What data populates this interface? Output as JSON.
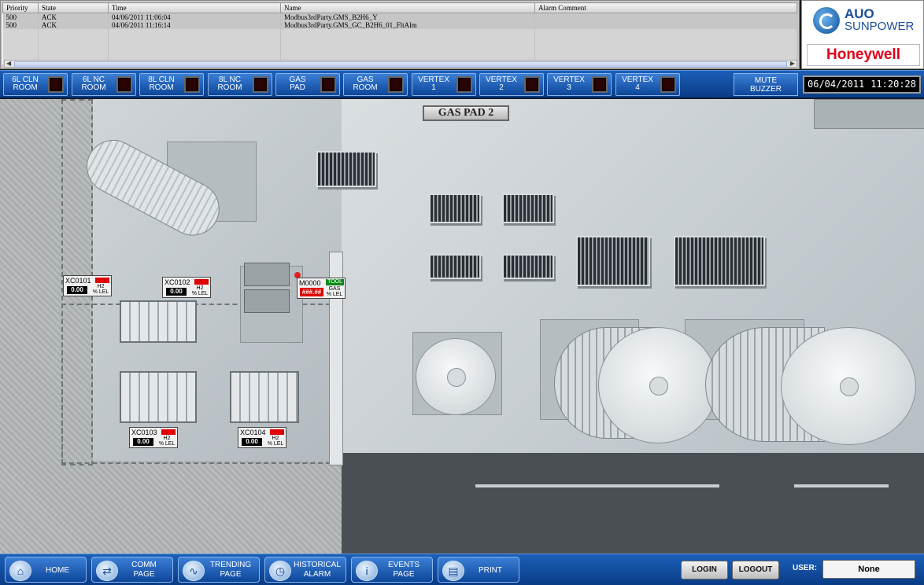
{
  "alarm_table": {
    "columns": [
      "Priority",
      "State",
      "Time",
      "Name",
      "Alarm Comment"
    ],
    "rows": [
      [
        "500",
        "ACK",
        "04/06/2011 11:06:04",
        "Modbus3rdParty.GMS_B2H6_Y",
        ""
      ],
      [
        "500",
        "ACK",
        "04/06/2011 11:16:14",
        "Modbus3rdParty.GMS_GC_B2H6_01_FltAlm",
        ""
      ]
    ]
  },
  "logos": {
    "auo": "AUO",
    "sunpower": "SUNPOWER",
    "honeywell": "Honeywell"
  },
  "status_bar": {
    "zones": [
      {
        "line1": "6L CLN",
        "line2": "ROOM"
      },
      {
        "line1": "6L NC",
        "line2": "ROOM"
      },
      {
        "line1": "8L CLN",
        "line2": "ROOM"
      },
      {
        "line1": "8L NC",
        "line2": "ROOM"
      },
      {
        "line1": "GAS",
        "line2": "PAD"
      },
      {
        "line1": "GAS",
        "line2": "ROOM"
      },
      {
        "line1": "VERTEX",
        "line2": "1"
      },
      {
        "line1": "VERTEX",
        "line2": "2"
      },
      {
        "line1": "VERTEX",
        "line2": "3"
      },
      {
        "line1": "VERTEX",
        "line2": "4"
      }
    ],
    "mute": {
      "line1": "MUTE",
      "line2": "BUZZER"
    },
    "date": "06/04/2011",
    "time": "11:20:28"
  },
  "scene": {
    "title": "GAS PAD 2",
    "gauges": [
      {
        "tag": "XC0101",
        "value": "0.00",
        "gas": "H2",
        "unit": "% LEL"
      },
      {
        "tag": "XC0102",
        "value": "0.00",
        "gas": "H2",
        "unit": "% LEL"
      },
      {
        "tag": "XC0103",
        "value": "0.00",
        "gas": "H2",
        "unit": "% LEL"
      },
      {
        "tag": "XC0104",
        "value": "0.00",
        "gas": "H2",
        "unit": "% LEL"
      }
    ],
    "tool_gauge": {
      "tag": "M0000",
      "status": "TOOL",
      "value": "###.##",
      "gas": "GAS",
      "unit": "% LEL"
    }
  },
  "nav": {
    "buttons": [
      {
        "line1": "HOME",
        "line2": ""
      },
      {
        "line1": "COMM",
        "line2": "PAGE"
      },
      {
        "line1": "TRENDING",
        "line2": "PAGE"
      },
      {
        "line1": "HISTORICAL",
        "line2": "ALARM"
      },
      {
        "line1": "EVENTS",
        "line2": "PAGE"
      },
      {
        "line1": "PRINT",
        "line2": ""
      }
    ],
    "icons": [
      "home-icon",
      "network-icon",
      "chart-icon",
      "clock-icon",
      "info-icon",
      "printer-icon"
    ],
    "login": "LOGIN",
    "logout": "LOGOUT",
    "user_label": "USER:",
    "user_value": "None"
  },
  "colors": {
    "bar_blue": "#0a3c86",
    "alarm_red": "#e00000",
    "tool_green": "#0a8a1a"
  }
}
